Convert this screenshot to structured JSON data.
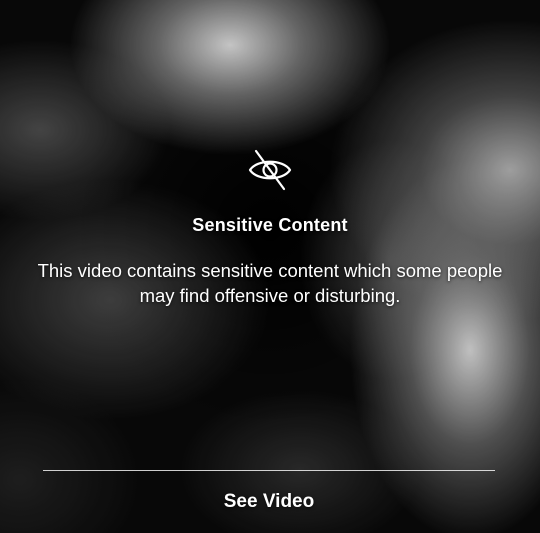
{
  "warning": {
    "icon": "eye-slash-icon",
    "title": "Sensitive Content",
    "message": "This video contains sensitive content which some people may find offensive or disturbing.",
    "action_label": "See Video"
  },
  "colors": {
    "text": "#ffffff",
    "background": "#0a0a0a"
  }
}
